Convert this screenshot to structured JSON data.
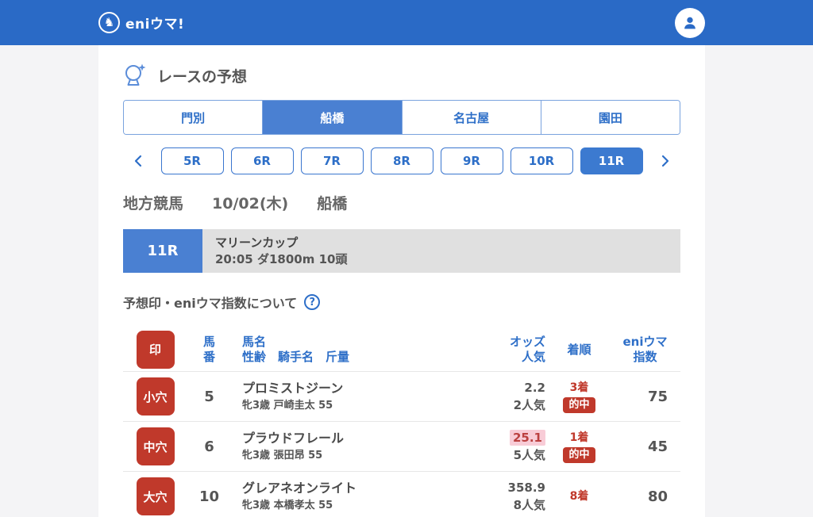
{
  "header": {
    "logo_text": "eniウマ!"
  },
  "icons": {
    "logo_horse": "♞",
    "help": "?"
  },
  "section": {
    "title": "レースの予想",
    "info_label": "予想印・eniウマ指数について"
  },
  "venue_tabs": [
    {
      "label": "門別",
      "selected": false
    },
    {
      "label": "船橋",
      "selected": true
    },
    {
      "label": "名古屋",
      "selected": false
    },
    {
      "label": "園田",
      "selected": false
    }
  ],
  "race_nav": [
    {
      "label": "5R",
      "selected": false
    },
    {
      "label": "6R",
      "selected": false
    },
    {
      "label": "7R",
      "selected": false
    },
    {
      "label": "8R",
      "selected": false
    },
    {
      "label": "9R",
      "selected": false
    },
    {
      "label": "10R",
      "selected": false
    },
    {
      "label": "11R",
      "selected": true
    }
  ],
  "race_meta": {
    "category": "地方競馬",
    "date": "10/02(木)",
    "venue": "船橋"
  },
  "race_banner": {
    "race_no": "11R",
    "title": "マリーンカップ",
    "details": "20:05 ダ1800m 10頭"
  },
  "table": {
    "header": {
      "mark": "印",
      "number_line1": "馬",
      "number_line2": "番",
      "name_line1": "馬名",
      "name_line2": "性齢　騎手名　斤量",
      "odds_line1": "オッズ",
      "odds_line2": "人気",
      "result": "着順",
      "index_line1": "eniウマ",
      "index_line2": "指数"
    },
    "rows": [
      {
        "mark": "小穴",
        "number": "5",
        "name": "プロミストジーン",
        "detail": "牝3歳 戸崎圭太 55",
        "odds": "2.2",
        "popularity": "2人気",
        "result": "3着",
        "hit": "的中",
        "index": "75"
      },
      {
        "mark": "中穴",
        "number": "6",
        "name": "プラウドフレール",
        "detail": "牝3歳 張田昂 55",
        "odds": "25.1",
        "popularity": "5人気",
        "result": "1着",
        "hit": "的中",
        "index": "45"
      },
      {
        "mark": "大穴",
        "number": "10",
        "name": "グレアネオンライト",
        "detail": "牝3歳 本橋孝太 55",
        "odds": "358.9",
        "popularity": "8人気",
        "result": "8着",
        "index": "80"
      }
    ]
  },
  "colors": {
    "header_blue": "#2a6ac6",
    "accent_blue": "#2e6fc8",
    "selected_blue": "#4a80d2",
    "mark_red": "#c0392b",
    "odds_highlight_pink": "#f8ccd7",
    "banner_gray": "#e0e0e0"
  }
}
